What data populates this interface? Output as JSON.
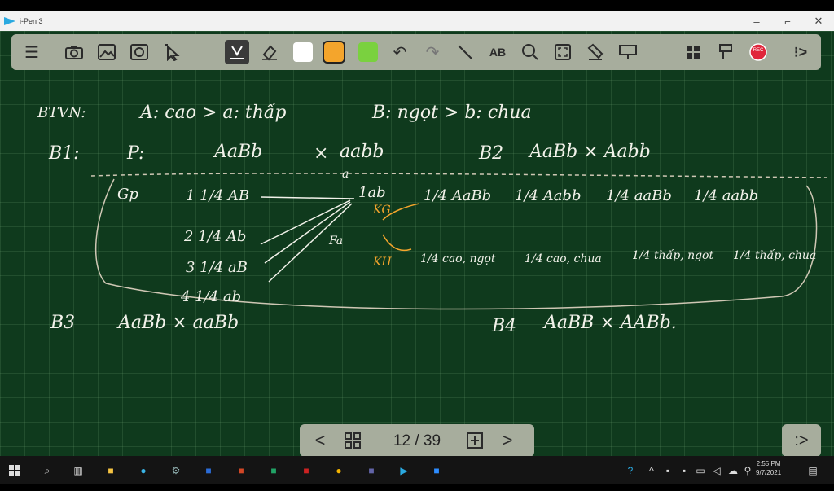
{
  "window": {
    "title": "i-Pen 3",
    "minimize": "‒",
    "restore": "⌐",
    "close": "✕"
  },
  "toolbar": {
    "icons": [
      "menu-icon",
      "camera-icon",
      "image-icon",
      "screen-capture-icon",
      "select-icon",
      "pen-icon",
      "eraser-icon",
      "undo-icon",
      "redo-icon",
      "line-icon",
      "text-icon",
      "search-icon",
      "fullscreen-icon",
      "highlighter-icon",
      "presenter-icon",
      "windows-icon",
      "pointer-icon",
      "record-icon",
      "expand-icon"
    ],
    "colors": {
      "white": "#ffffff",
      "orange": "#f4a52c",
      "green": "#7ad13f",
      "record": "#e0263b"
    },
    "record_label": "REC"
  },
  "board": {
    "line1": {
      "label": "BTVN:",
      "text1": "A: cao > a: thấp",
      "text2": "B: ngọt > b: chua"
    },
    "b1": {
      "label": "B1:",
      "p": "P:",
      "cross_left": "AaBb",
      "cross_x": "×",
      "cross_right": "aabb"
    },
    "b2": {
      "label": "B2",
      "cross": "AaBb × Aabb"
    },
    "gp": {
      "label": "Gp",
      "items": [
        "1  1/4 AB",
        "2  1/4 Ab",
        "3  1/4 aB",
        "4  1/4 ab"
      ],
      "right": "1ab",
      "mark_a": "a",
      "kc": "KG",
      "kh": "KH",
      "genotypes": [
        "1/4 AaBb",
        "1/4 Aabb",
        "1/4 aaBb",
        "1/4 aabb"
      ],
      "phenotypes": [
        "1/4 cao, ngọt",
        "1/4 cao, chua",
        "1/4 thấp, ngọt",
        "1/4 thấp, chua"
      ],
      "fl": "Fa"
    },
    "b3": {
      "label": "B3",
      "cross": "AaBb × aaBb"
    },
    "b4": {
      "label": "B4",
      "cross": "AaBB × AABb."
    }
  },
  "pager": {
    "prev": "<",
    "grid": "⊞",
    "page": "12 / 39",
    "add": "⊞",
    "next": ">"
  },
  "expand_button": ":>",
  "taskbar": {
    "icons": [
      "start-icon",
      "search-icon",
      "task-view-icon",
      "file-explorer-icon",
      "edge-icon",
      "settings-icon",
      "word-icon",
      "powerpoint-icon",
      "excel-icon",
      "onenote-icon",
      "chrome-icon",
      "teams-icon",
      "ipen-icon",
      "zoom-icon"
    ],
    "clock_time": "2:55 PM",
    "clock_date": "9/7/2021"
  }
}
